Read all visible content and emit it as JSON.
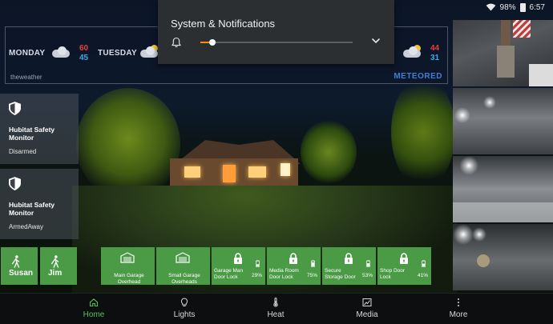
{
  "status_bar": {
    "battery": "98%",
    "battery_level": 0.98,
    "time": "6:57"
  },
  "notification_shade": {
    "title": "System & Notifications",
    "volume_level": 0.08
  },
  "weather": {
    "days": [
      {
        "name": "MONDAY",
        "high": "60",
        "low": "45"
      },
      {
        "name": "TUESDAY",
        "high": "",
        "low": ""
      },
      {
        "name": "",
        "high": "44",
        "low": "31"
      }
    ],
    "source": "theweather",
    "brand": "METEORED"
  },
  "hsm_tiles": [
    {
      "name": "Hubitat Safety Monitor",
      "state": "Disarmed"
    },
    {
      "name": "Hubitat Safety Monitor",
      "state": "ArmedAway"
    }
  ],
  "presence": [
    {
      "name": "Susan"
    },
    {
      "name": "Jim"
    }
  ],
  "garage_doors": [
    {
      "label": "Main Garage Overhead"
    },
    {
      "label": "Small Garage Overheads"
    }
  ],
  "locks": [
    {
      "label": "Garage Man Door Lock",
      "battery": "29%"
    },
    {
      "label": "Media Room Door Lock",
      "battery": "75%"
    },
    {
      "label": "Secure Storage Door",
      "battery": "53%"
    },
    {
      "label": "Shop Door Lock",
      "battery": "41%"
    }
  ],
  "colors": {
    "tile_green": "#4a9a46",
    "nav_active": "#57c250",
    "volume_accent": "#ff8a00"
  },
  "nav": [
    {
      "label": "Home",
      "icon": "home-icon",
      "active": true
    },
    {
      "label": "Lights",
      "icon": "lightbulb-icon",
      "active": false
    },
    {
      "label": "Heat",
      "icon": "thermometer-icon",
      "active": false
    },
    {
      "label": "Media",
      "icon": "media-icon",
      "active": false
    },
    {
      "label": "More",
      "icon": "more-icon",
      "active": false
    }
  ]
}
